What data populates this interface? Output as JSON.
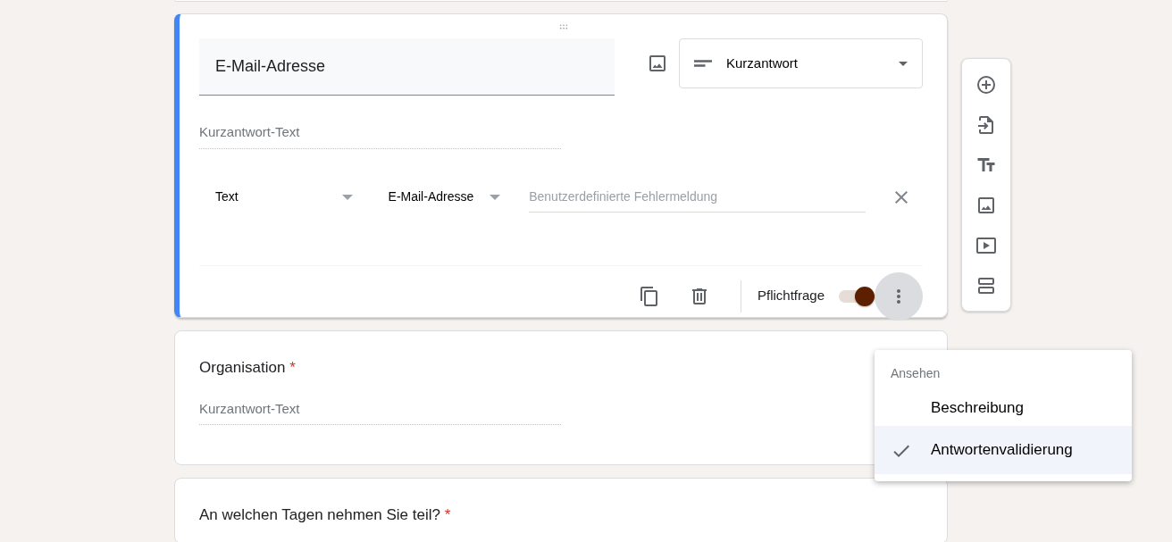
{
  "question_card": {
    "title": "E-Mail-Adresse",
    "type_dropdown": "Kurzantwort",
    "answer_placeholder": "Kurzantwort-Text",
    "validation": {
      "type": "Text",
      "condition": "E-Mail-Adresse",
      "error_placeholder": "Benutzerdefinierte Fehlermeldung"
    },
    "required_label": "Pflichtfrage",
    "required": true
  },
  "questions": [
    {
      "title": "Organisation",
      "marker": "*",
      "answer_placeholder": "Kurzantwort-Text"
    },
    {
      "title": "An welchen Tagen nehmen Sie teil?",
      "marker": "*"
    }
  ],
  "menu": {
    "header": "Ansehen",
    "items": [
      {
        "label": "Beschreibung",
        "checked": false
      },
      {
        "label": "Antwortenvalidierung",
        "checked": true
      }
    ]
  }
}
